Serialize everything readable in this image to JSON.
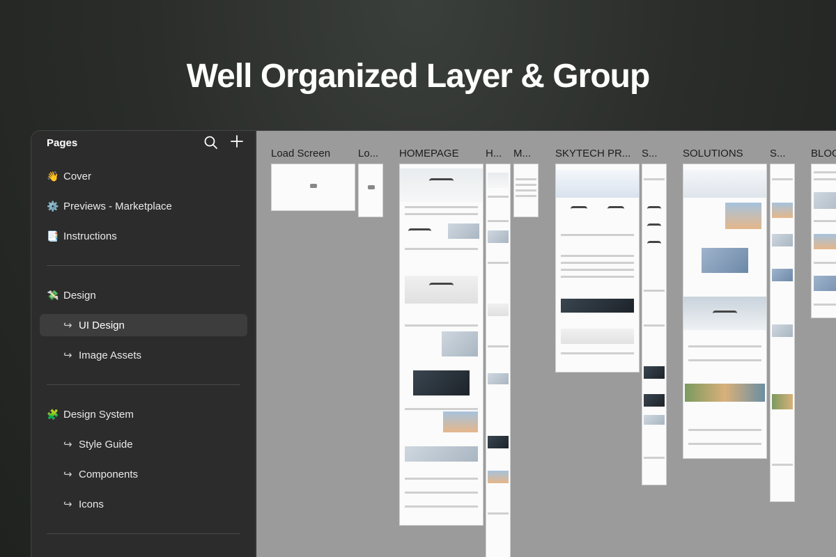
{
  "headline": "Well Organized Layer & Group",
  "sidebar": {
    "title": "Pages",
    "search_icon": "search-icon",
    "add_icon": "plus-icon",
    "items": [
      {
        "emoji": "👋",
        "label": "Cover"
      },
      {
        "emoji": "⚙️",
        "label": "Previews - Marketplace"
      },
      {
        "emoji": "📑",
        "label": "Instructions"
      },
      {
        "emoji": "💸",
        "label": "Design"
      },
      {
        "arrow": "↪",
        "label": "UI Design"
      },
      {
        "arrow": "↪",
        "label": "Image Assets"
      },
      {
        "emoji": "🧩",
        "label": "Design System"
      },
      {
        "arrow": "↪",
        "label": "Style Guide"
      },
      {
        "arrow": "↪",
        "label": "Components"
      },
      {
        "arrow": "↪",
        "label": "Icons"
      }
    ]
  },
  "canvas": {
    "frames": [
      {
        "label": "Load Screen"
      },
      {
        "label": "Lo..."
      },
      {
        "label": "HOMEPAGE"
      },
      {
        "label": "H..."
      },
      {
        "label": "M..."
      },
      {
        "label": "SKYTECH PR..."
      },
      {
        "label": "S..."
      },
      {
        "label": "SOLUTIONS"
      },
      {
        "label": "S..."
      },
      {
        "label": "BLOG"
      }
    ]
  }
}
